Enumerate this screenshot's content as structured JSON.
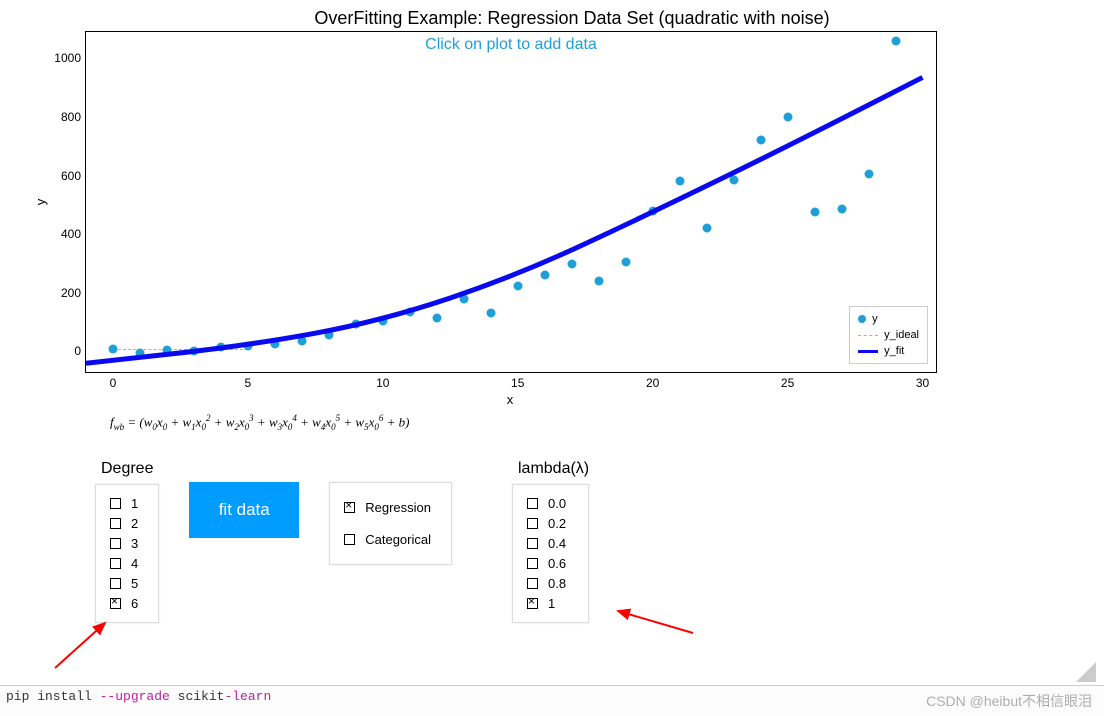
{
  "chart_data": {
    "type": "scatter+line",
    "title": "OverFitting Example: Regression Data Set (quadratic with noise)",
    "subtitle": "Click on plot to add data",
    "xlabel": "x",
    "ylabel": "y",
    "xlim": [
      -1,
      30.5
    ],
    "ylim": [
      -70,
      1090
    ],
    "xticks": [
      0,
      5,
      10,
      15,
      20,
      25,
      30
    ],
    "yticks": [
      0,
      200,
      400,
      600,
      800,
      1000
    ],
    "series": [
      {
        "name": "y",
        "type": "scatter",
        "x": [
          0,
          1,
          2,
          3,
          4,
          5,
          6,
          7,
          8,
          9,
          10,
          11,
          12,
          13,
          14,
          15,
          16,
          17,
          18,
          19,
          20,
          21,
          22,
          23,
          24,
          25,
          26,
          27,
          28,
          29
        ],
        "y": [
          10,
          -5,
          5,
          0,
          15,
          20,
          25,
          35,
          55,
          95,
          105,
          135,
          115,
          180,
          130,
          225,
          260,
          300,
          240,
          305,
          480,
          580,
          420,
          585,
          720,
          800,
          475,
          485,
          605,
          1060
        ]
      },
      {
        "name": "y_ideal",
        "type": "dashed",
        "color": "orange",
        "x": [
          0,
          30
        ],
        "y": [
          0,
          0
        ],
        "note": "dashed reference near y=0 at left"
      },
      {
        "name": "y_fit",
        "type": "line",
        "color": "#0a0af0",
        "x": [
          -1,
          5,
          10,
          15,
          20,
          25,
          30
        ],
        "y": [
          -40,
          20,
          105,
          260,
          475,
          700,
          935
        ]
      }
    ],
    "legend": [
      "y",
      "y_ideal",
      "y_fit"
    ]
  },
  "formula": "f_wb = (w0x0 + w1x0^2 + w2x0^3 + w3x0^4 + w4x0^5 + w5x0^6 + b)",
  "controls": {
    "degree": {
      "title": "Degree",
      "options": [
        "1",
        "2",
        "3",
        "4",
        "5",
        "6"
      ],
      "selected": "6"
    },
    "fit_button": "fit data",
    "type": {
      "options": [
        "Regression",
        "Categorical"
      ],
      "selected": "Regression"
    },
    "lambda": {
      "title": "lambda(λ)",
      "options": [
        "0.0",
        "0.2",
        "0.4",
        "0.6",
        "0.8",
        "1"
      ],
      "selected": "1"
    }
  },
  "terminal": {
    "prefix": "pip install ",
    "cmd1": "--upgrade",
    "mid": " scikit",
    "cmd2": "-learn"
  },
  "watermark": "CSDN @heibut不相信眼泪"
}
